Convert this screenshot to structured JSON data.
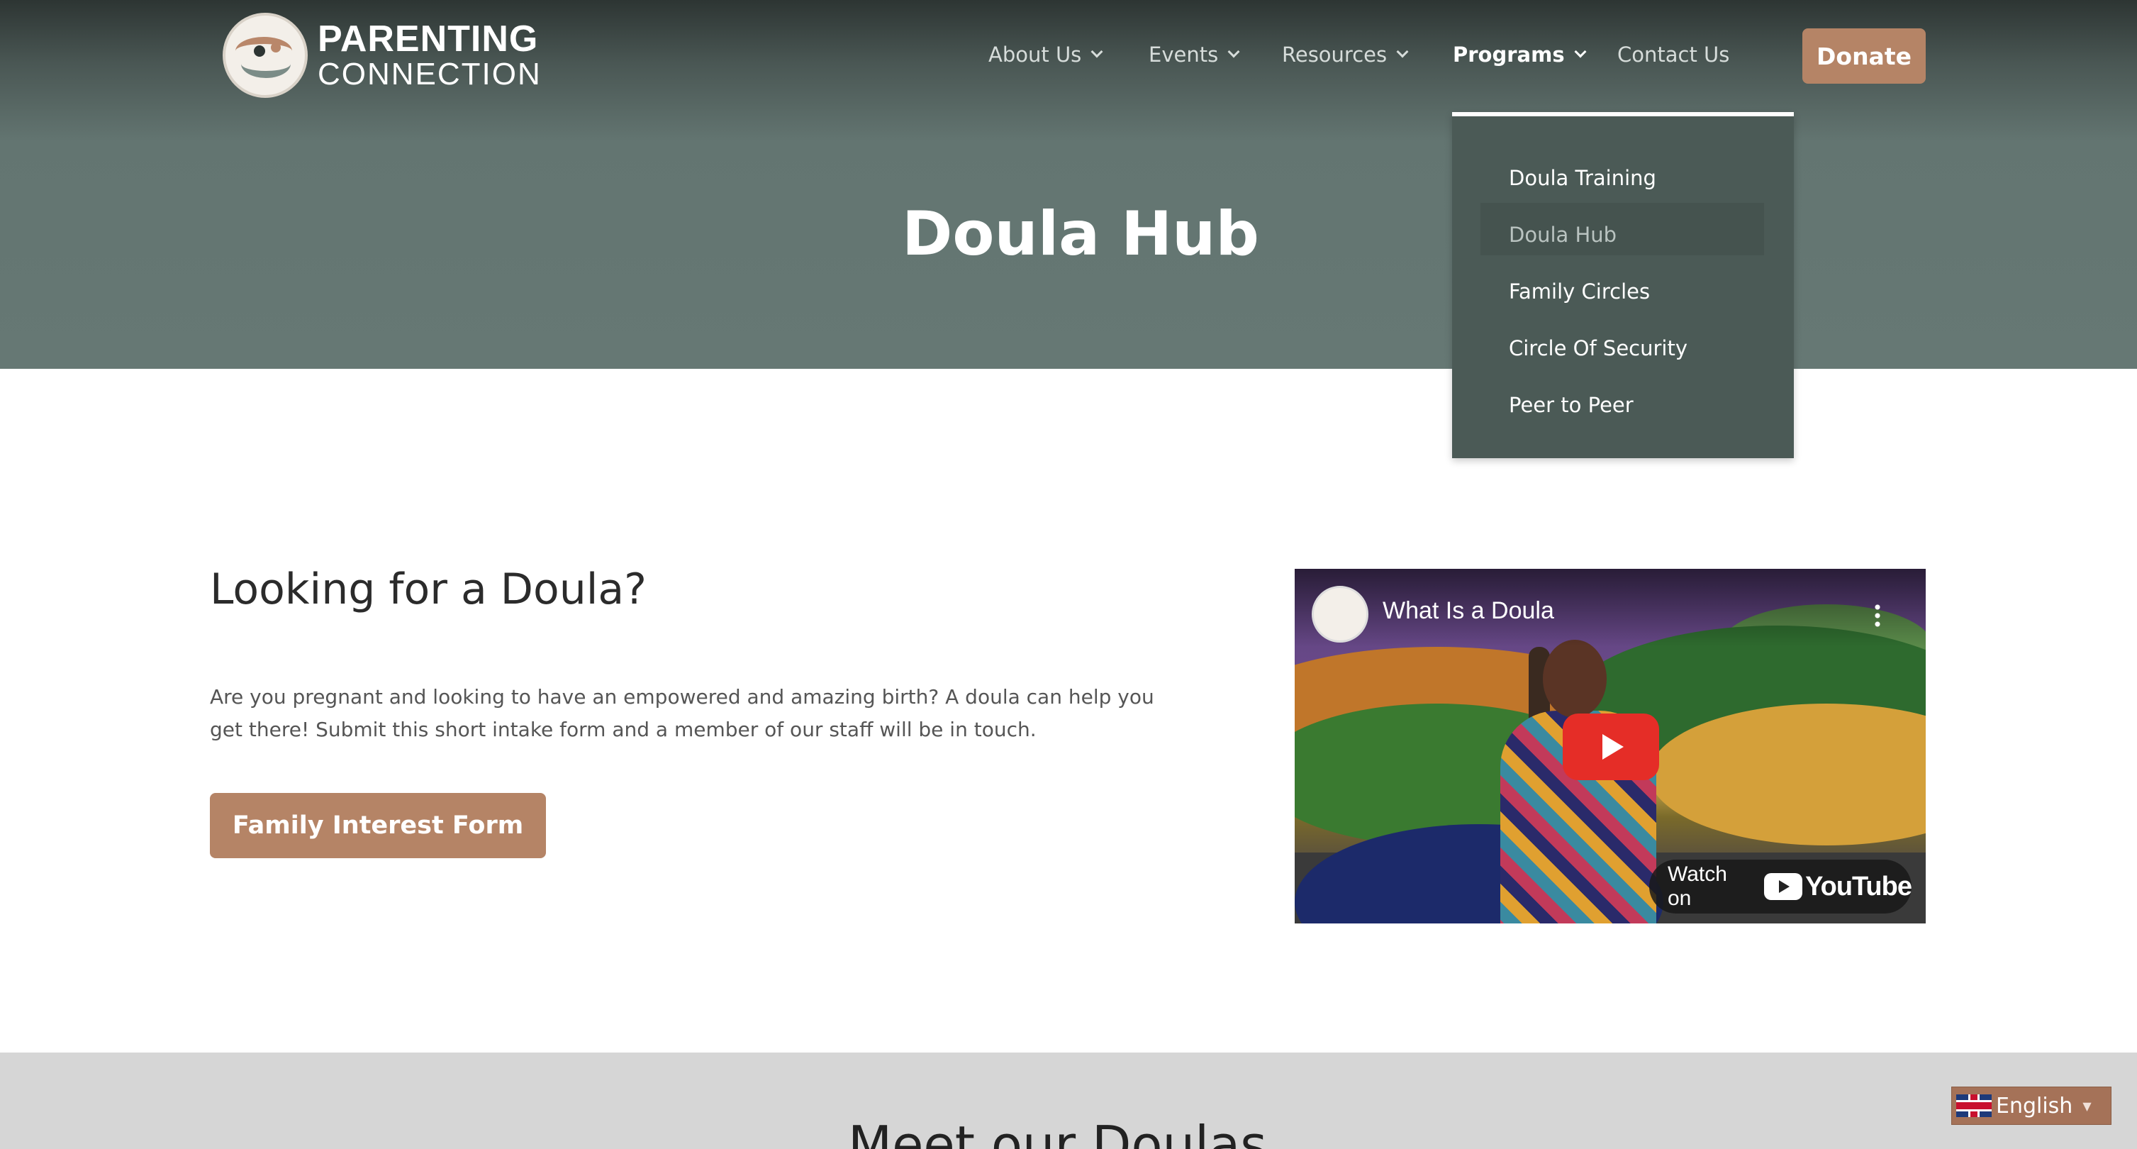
{
  "header": {
    "logo": {
      "line1": "PARENTING",
      "line2": "CONNECTION"
    },
    "nav": [
      {
        "label": "About Us",
        "has_dropdown": true
      },
      {
        "label": "Events",
        "has_dropdown": true
      },
      {
        "label": "Resources",
        "has_dropdown": true
      },
      {
        "label": "Programs",
        "has_dropdown": true,
        "active": true
      },
      {
        "label": "Contact Us",
        "has_dropdown": false
      }
    ],
    "donate_label": "Donate"
  },
  "dropdown": {
    "items": [
      {
        "label": "Doula Training"
      },
      {
        "label": "Doula Hub",
        "current": true
      },
      {
        "label": "Family Circles"
      },
      {
        "label": "Circle Of Security"
      },
      {
        "label": "Peer to Peer"
      }
    ]
  },
  "hero": {
    "title": "Doula Hub"
  },
  "main": {
    "heading": "Looking for a Doula?",
    "paragraph_line1": "Are you pregnant and looking to have an empowered and amazing birth? A doula can help you",
    "paragraph_line2": "get there! Submit this short intake form and a member of our staff will be in touch.",
    "cta_label": "Family Interest Form"
  },
  "video": {
    "title": "What Is a Doula",
    "watch_on": "Watch on",
    "platform": "YouTube"
  },
  "bottom": {
    "title": "Meet our Doulas"
  },
  "language": {
    "label": "English",
    "caret": "▼"
  },
  "colors": {
    "accent": "#b58466",
    "hero_bg": "#667874",
    "dropdown_bg": "#4b5a56",
    "youtube_red": "#e52d27"
  }
}
